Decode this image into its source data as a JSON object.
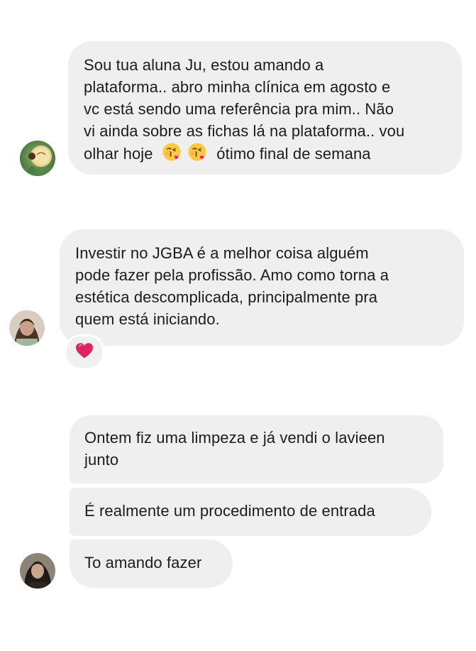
{
  "conversation": [
    {
      "lines": [
        "Sou tua aluna Ju, estou amando a",
        "plataforma.. abro minha clínica em agosto e",
        "vc está sendo uma referência pra mim..  Não",
        "vi ainda sobre as fichas lá na plataforma.. vou"
      ],
      "last_line_prefix": "olhar hoje",
      "last_line_emojis": [
        "kissing-heart-emoji",
        "kissing-heart-emoji"
      ],
      "last_line_suffix": "ótimo final de semana"
    },
    {
      "lines": [
        "Investir no JGBA é a melhor coisa alguém",
        "pode fazer pela profissão. Amo como torna a",
        "estética descomplicada, principalmente pra",
        "quem está iniciando."
      ],
      "reaction": "red-heart-emoji"
    },
    {
      "messages": [
        [
          "Ontem fiz uma limpeza e já vendi o lavieen",
          "junto"
        ],
        [
          "É realmente um procedimento de entrada"
        ],
        [
          "To amando fazer"
        ]
      ]
    }
  ],
  "colors": {
    "bubble": "#efefef",
    "text": "#1c1c1e",
    "background": "#ffffff",
    "heart": "#e0245e"
  }
}
